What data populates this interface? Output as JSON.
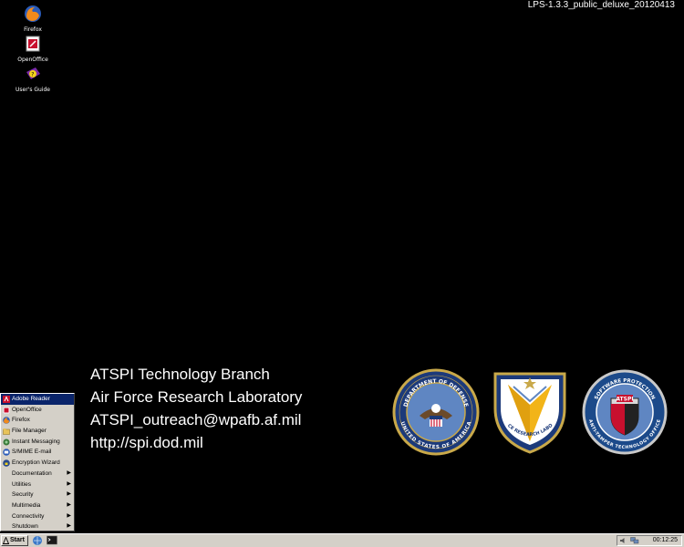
{
  "version_label": "LPS-1.3.3_public_deluxe_20120413",
  "desktop_icons": [
    {
      "label": "Firefox",
      "icon": "firefox-icon"
    },
    {
      "label": "OpenOffice",
      "icon": "openoffice-icon"
    },
    {
      "label": "User's Guide",
      "icon": "users-guide-icon"
    }
  ],
  "info": {
    "line1": "ATSPI Technology Branch",
    "line2": "Air Force Research  Laboratory",
    "line3": "ATSPI_outreach@wpafb.af.mil",
    "line4": "http://spi.dod.mil"
  },
  "seals": [
    {
      "name": "dod-seal",
      "top_text": "DEPARTMENT OF DEFENSE",
      "bottom_text": "UNITED STATES OF AMERICA"
    },
    {
      "name": "afrl-shield",
      "text": "AIR FORCE RESEARCH LABORATORY"
    },
    {
      "name": "atspi-seal",
      "center_text": "ATSPI",
      "top_text": "SOFTWARE PROTECTION",
      "bottom_text": "ANTI-TAMPER TECHNOLOGY OFFICE"
    }
  ],
  "start_menu": {
    "items": [
      {
        "label": "Adobe Reader",
        "selected": true,
        "submenu": false,
        "icon": "adobe-reader-icon"
      },
      {
        "label": "OpenOffice",
        "selected": false,
        "submenu": false,
        "icon": "openoffice-icon"
      },
      {
        "label": "Firefox",
        "selected": false,
        "submenu": false,
        "icon": "firefox-icon"
      },
      {
        "label": "File Manager",
        "selected": false,
        "submenu": false,
        "icon": "file-manager-icon"
      },
      {
        "label": "Instant Messaging",
        "selected": false,
        "submenu": false,
        "icon": "instant-messaging-icon"
      },
      {
        "label": "S/MIME E-mail",
        "selected": false,
        "submenu": false,
        "icon": "email-icon"
      },
      {
        "label": "Encryption Wizard",
        "selected": false,
        "submenu": false,
        "icon": "encryption-wizard-icon"
      },
      {
        "label": "Documentation",
        "selected": false,
        "submenu": true,
        "icon": ""
      },
      {
        "label": "Utilities",
        "selected": false,
        "submenu": true,
        "icon": ""
      },
      {
        "label": "Security",
        "selected": false,
        "submenu": true,
        "icon": ""
      },
      {
        "label": "Multimedia",
        "selected": false,
        "submenu": true,
        "icon": ""
      },
      {
        "label": "Connectivity",
        "selected": false,
        "submenu": true,
        "icon": ""
      },
      {
        "label": "Shutdown",
        "selected": false,
        "submenu": true,
        "icon": ""
      }
    ]
  },
  "taskbar": {
    "start_label": "Start",
    "clock": "00:12:25",
    "quick_launch": [
      "browser-icon",
      "terminal-icon"
    ],
    "tray_icons": [
      "volume-icon",
      "network-icon"
    ]
  }
}
